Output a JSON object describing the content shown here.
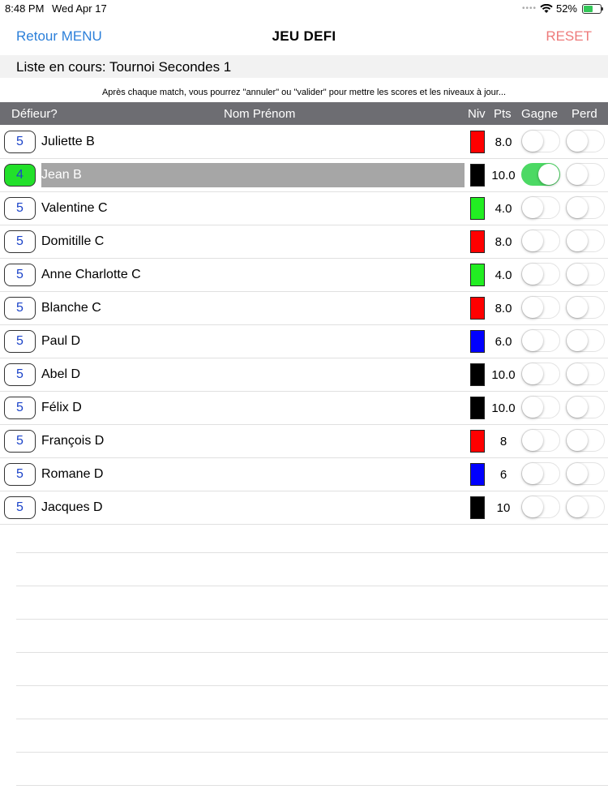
{
  "status_bar": {
    "time": "8:48 PM",
    "date": "Wed Apr 17",
    "battery": "52%"
  },
  "nav": {
    "back_label": "Retour MENU",
    "title": "JEU  DEFI",
    "reset_label": "RESET"
  },
  "list_title": "Liste en cours: Tournoi Secondes 1",
  "hint": "Après chaque match, vous pourrez \"annuler\" ou \"valider\" pour mettre les scores et les niveaux à jour...",
  "table_header": {
    "defieur": "Défieur?",
    "nom": "Nom Prénom",
    "niv": "Niv",
    "pts": "Pts",
    "gagne": "Gagne",
    "perd": "Perd"
  },
  "colors": {
    "red": "#ff0000",
    "black": "#000000",
    "green": "#22ee22",
    "blue": "#0000ff",
    "accent": "#2b7fd9",
    "reset": "#ee7a7a",
    "toggle_on": "#4cd964"
  },
  "players": [
    {
      "challenge": "5",
      "name": "Juliette B",
      "niv_color": "#ff0000",
      "pts": "8.0",
      "gagne": false,
      "perd": false,
      "selected": false
    },
    {
      "challenge": "4",
      "name": "Jean B",
      "niv_color": "#000000",
      "pts": "10.0",
      "gagne": true,
      "perd": false,
      "selected": true
    },
    {
      "challenge": "5",
      "name": "Valentine C",
      "niv_color": "#22ee22",
      "pts": "4.0",
      "gagne": false,
      "perd": false,
      "selected": false
    },
    {
      "challenge": "5",
      "name": "Domitille C",
      "niv_color": "#ff0000",
      "pts": "8.0",
      "gagne": false,
      "perd": false,
      "selected": false
    },
    {
      "challenge": "5",
      "name": "Anne Charlotte C",
      "niv_color": "#22ee22",
      "pts": "4.0",
      "gagne": false,
      "perd": false,
      "selected": false
    },
    {
      "challenge": "5",
      "name": "Blanche C",
      "niv_color": "#ff0000",
      "pts": "8.0",
      "gagne": false,
      "perd": false,
      "selected": false
    },
    {
      "challenge": "5",
      "name": "Paul D",
      "niv_color": "#0000ff",
      "pts": "6.0",
      "gagne": false,
      "perd": false,
      "selected": false
    },
    {
      "challenge": "5",
      "name": "Abel D",
      "niv_color": "#000000",
      "pts": "10.0",
      "gagne": false,
      "perd": false,
      "selected": false
    },
    {
      "challenge": "5",
      "name": "Félix D",
      "niv_color": "#000000",
      "pts": "10.0",
      "gagne": false,
      "perd": false,
      "selected": false
    },
    {
      "challenge": "5",
      "name": "François D",
      "niv_color": "#ff0000",
      "pts": "8",
      "gagne": false,
      "perd": false,
      "selected": false
    },
    {
      "challenge": "5",
      "name": "Romane D",
      "niv_color": "#0000ff",
      "pts": "6",
      "gagne": false,
      "perd": false,
      "selected": false
    },
    {
      "challenge": "5",
      "name": "Jacques D",
      "niv_color": "#000000",
      "pts": "10",
      "gagne": false,
      "perd": false,
      "selected": false
    }
  ]
}
